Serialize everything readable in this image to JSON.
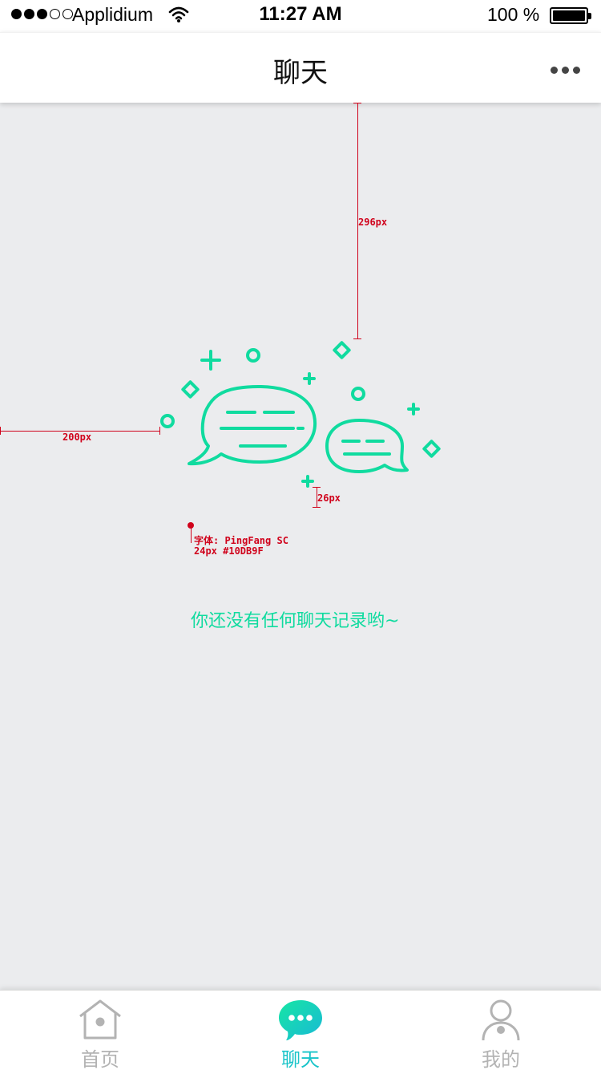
{
  "status_bar": {
    "carrier": "Applidium",
    "time": "11:27 AM",
    "battery": "100 %",
    "signal_bars_filled": 3,
    "signal_bars_total": 5
  },
  "nav": {
    "title": "聊天",
    "more_icon": "more-horizontal-icon"
  },
  "empty_state": {
    "message": "你还没有任何聊天记录哟~",
    "illustration_icon": "chat-bubbles-icon",
    "accent_color": "#10DB9F"
  },
  "annotations": {
    "top_spacing": "296px",
    "left_spacing": "200px",
    "text_gap": "26px",
    "font_note_line1": "字体: PingFang SC",
    "font_note_line2": "24px #10DB9F"
  },
  "tabs": [
    {
      "label": "首页",
      "icon": "home-icon",
      "active": false
    },
    {
      "label": "聊天",
      "icon": "chat-icon",
      "active": true
    },
    {
      "label": "我的",
      "icon": "user-icon",
      "active": false
    }
  ],
  "colors": {
    "active_tab": "#19c4c9",
    "inactive_tab": "#b3b3b3",
    "background": "#ebecee",
    "annotation": "#d0021b"
  }
}
